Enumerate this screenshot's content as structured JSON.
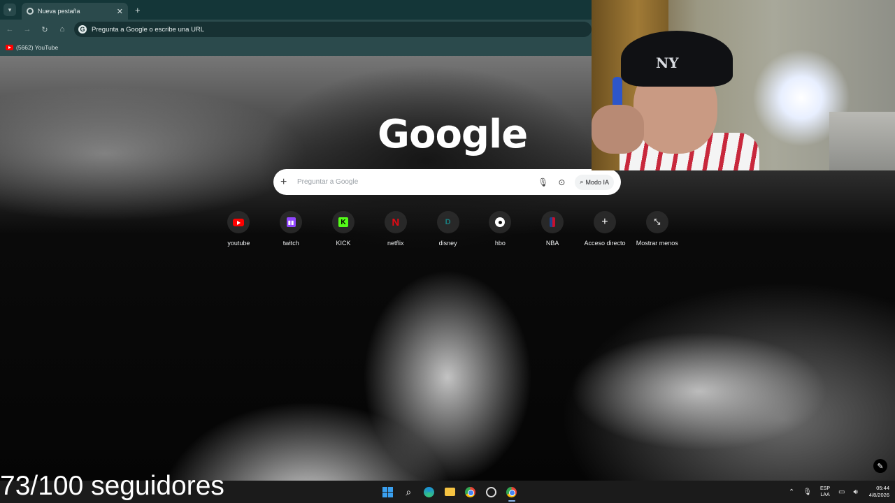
{
  "browser": {
    "tab_title": "Nueva pestaña",
    "omnibox_placeholder": "Pregunta a Google o escribe una URL",
    "bookmark_label": "(5662) YouTube"
  },
  "ntp": {
    "logo_text": "Google",
    "search_placeholder": "Preguntar a Google",
    "ai_mode_label": "Modo IA",
    "shortcuts": [
      {
        "label": "youtube",
        "icon": "youtube-icon"
      },
      {
        "label": "twitch",
        "icon": "twitch-icon"
      },
      {
        "label": "KICK",
        "icon": "kick-icon"
      },
      {
        "label": "netflix",
        "icon": "netflix-icon"
      },
      {
        "label": "disney",
        "icon": "disney-icon"
      },
      {
        "label": "hbo",
        "icon": "hbo-icon"
      },
      {
        "label": "NBA",
        "icon": "nba-icon"
      },
      {
        "label": "Acceso directo",
        "icon": "plus-icon"
      },
      {
        "label": "Mostrar menos",
        "icon": "collapse-icon"
      }
    ]
  },
  "overlay": {
    "followers_text": "73/100 seguidores"
  },
  "tray": {
    "lang_line1": "ESP",
    "lang_line2": "LAA",
    "time": "05:44",
    "date": "4/8/2026"
  },
  "colors": {
    "chrome_titlebar": "#143638",
    "chrome_toolbar": "#2b4a4c",
    "taskbar": "#1b1b1b"
  }
}
